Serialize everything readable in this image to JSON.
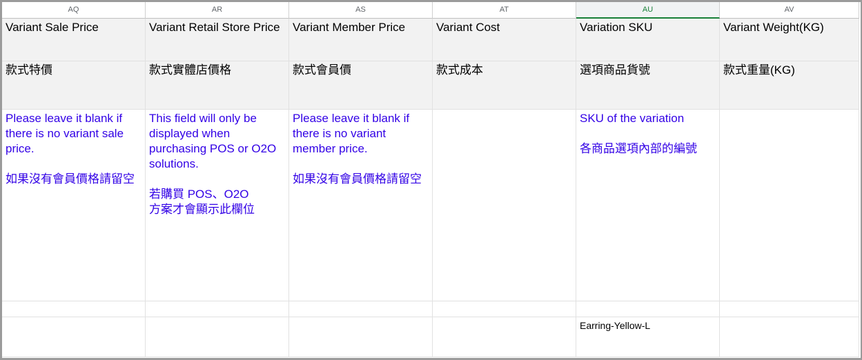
{
  "columns": [
    {
      "letter": "AQ",
      "header_en": "Variant Sale Price",
      "header_zh": "款式特價",
      "note_en": "Please leave it blank if there is no variant sale price.",
      "note_zh": "如果沒有會員價格請留空",
      "value": ""
    },
    {
      "letter": "AR",
      "header_en": "Variant Retail Store Price",
      "header_zh": "款式實體店價格",
      "note_en": "This field will only be displayed when purchasing POS or O2O solutions.",
      "note_zh_line1": "若購買 POS、O2O",
      "note_zh_line2": "方案才會顯示此欄位",
      "value": ""
    },
    {
      "letter": "AS",
      "header_en": "Variant Member Price",
      "header_zh": "款式會員價",
      "note_en": "Please leave it blank if there is no variant member price.",
      "note_zh": "如果沒有會員價格請留空",
      "value": ""
    },
    {
      "letter": "AT",
      "header_en": "Variant Cost",
      "header_zh": "款式成本",
      "value": ""
    },
    {
      "letter": "AU",
      "header_en": "Variation SKU",
      "header_zh": "選項商品貨號",
      "note_en": "SKU of the variation",
      "note_zh": "各商品選項內部的編號",
      "value": "Earring-Yellow-L"
    },
    {
      "letter": "AV",
      "header_en": "Variant Weight(KG)",
      "header_zh": "款式重量(KG)",
      "value": ""
    }
  ],
  "selected_column": "AU",
  "colors": {
    "note_text": "#3200e6",
    "header_fill": "#f2f2f2",
    "selected_accent": "#188038"
  }
}
